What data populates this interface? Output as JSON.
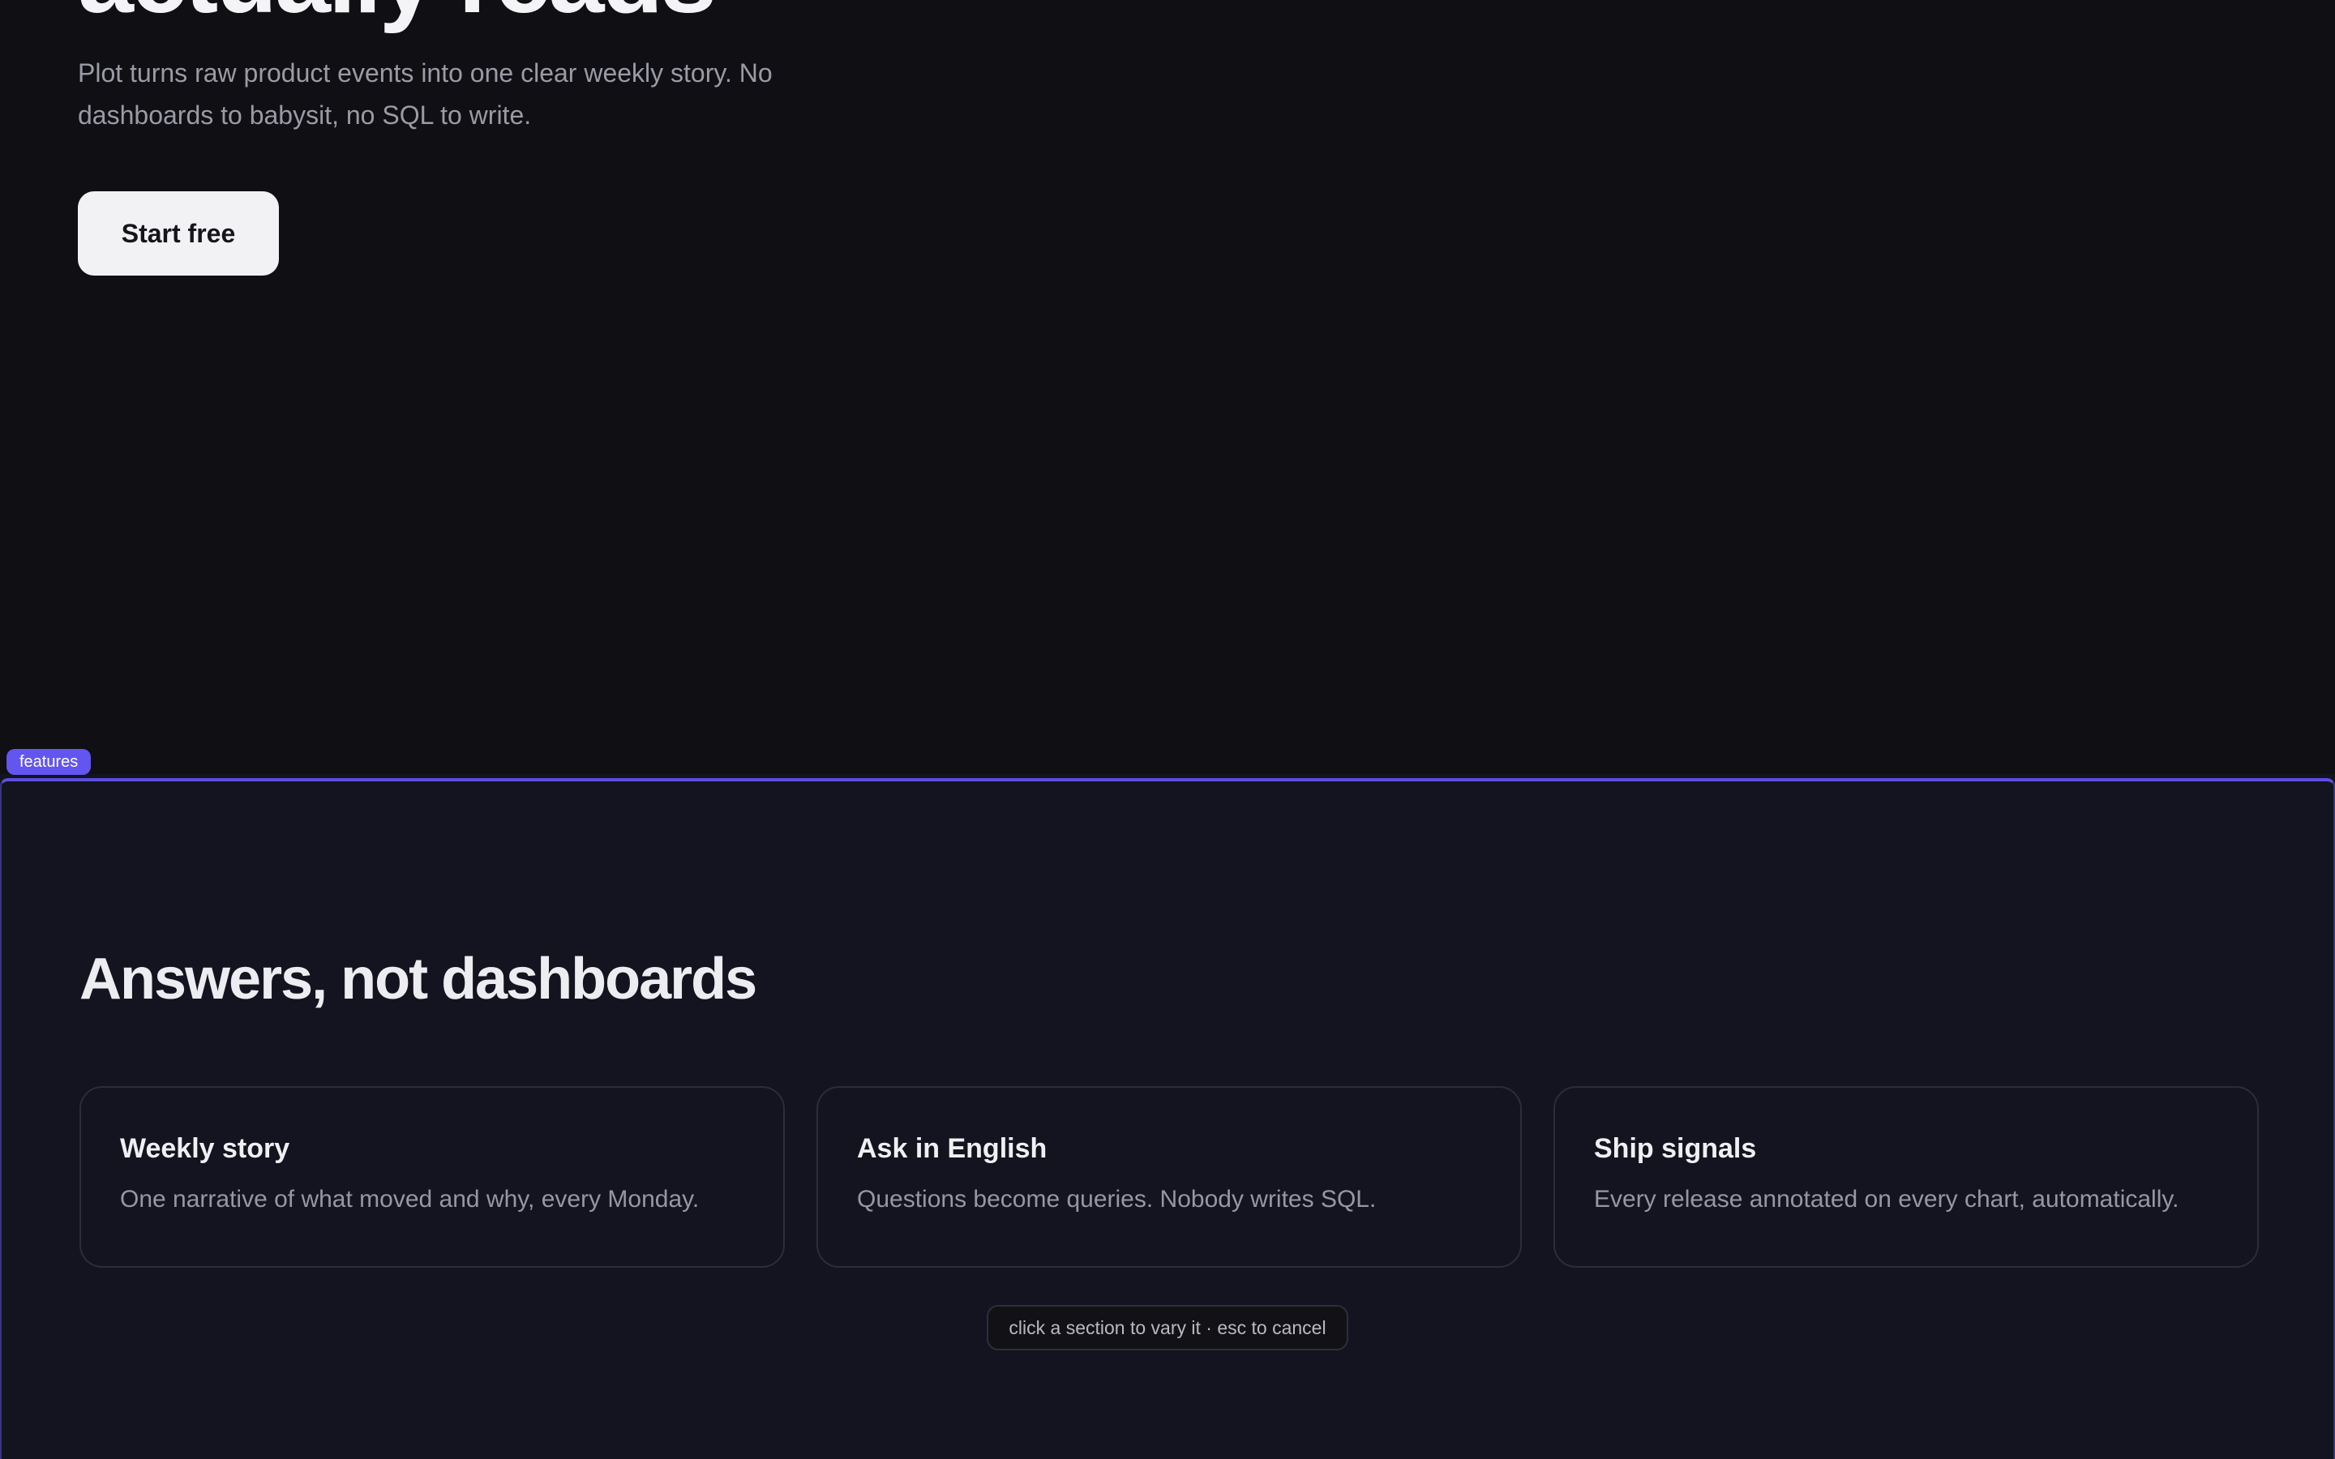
{
  "hero": {
    "title": "actually reads",
    "subtitle": "Plot turns raw product events into one clear weekly story. No dashboards to babysit, no SQL to write.",
    "cta_label": "Start free"
  },
  "section_tag": {
    "label": "features"
  },
  "features": {
    "title": "Answers, not dashboards",
    "cards": [
      {
        "title": "Weekly story",
        "description": "One narrative of what moved and why, every Monday."
      },
      {
        "title": "Ask in English",
        "description": "Questions become queries. Nobody writes SQL."
      },
      {
        "title": "Ship signals",
        "description": "Every release annotated on every chart, automatically."
      }
    ]
  },
  "hint": {
    "text": "click a section to vary it · esc to cancel"
  },
  "colors": {
    "hero_background": "#0f0f14",
    "section_background": "#141420",
    "accent": "#6355f0",
    "cta_background": "#f2f2f4"
  }
}
